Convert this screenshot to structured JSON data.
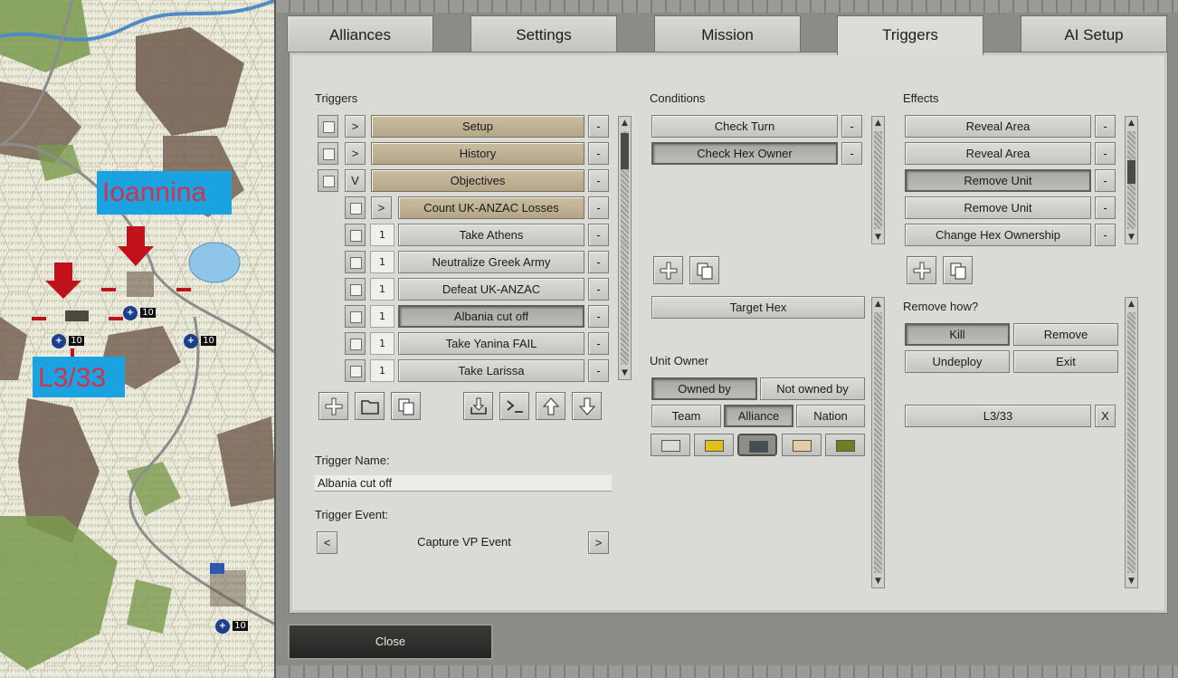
{
  "map": {
    "city_label": "Ioannina",
    "unit_label": "L3/33",
    "unit_strengths": [
      "10",
      "10",
      "10",
      "10"
    ]
  },
  "tabs": [
    "Alliances",
    "Settings",
    "Mission",
    "Triggers",
    "AI Setup"
  ],
  "active_tab": "Triggers",
  "triggers": {
    "header": "Triggers",
    "groups": [
      {
        "toggle": ">",
        "label": "Setup"
      },
      {
        "toggle": ">",
        "label": "History"
      },
      {
        "toggle": "V",
        "label": "Objectives"
      }
    ],
    "sub_group": {
      "toggle": ">",
      "label": "Count UK-ANZAC Losses"
    },
    "items": [
      {
        "num": "1",
        "label": "Take Athens"
      },
      {
        "num": "1",
        "label": "Neutralize Greek Army"
      },
      {
        "num": "1",
        "label": "Defeat UK-ANZAC"
      },
      {
        "num": "1",
        "label": "Albania cut off"
      },
      {
        "num": "1",
        "label": "Take Yanina FAIL"
      },
      {
        "num": "1",
        "label": "Take Larissa"
      }
    ],
    "remove_label": "-",
    "name_label": "Trigger Name:",
    "name_value": "Albania cut off",
    "event_label": "Trigger Event:",
    "event_value": "Capture VP Event",
    "prev": "<",
    "next": ">"
  },
  "conditions": {
    "header": "Conditions",
    "items": [
      "Check Turn",
      "Check Hex Owner"
    ],
    "target_hex": "Target Hex",
    "unit_owner_label": "Unit Owner",
    "owned_by": "Owned by",
    "not_owned_by": "Not owned by",
    "scope": [
      "Team",
      "Alliance",
      "Nation"
    ],
    "swatches": [
      "#d9dadc",
      "#e0c01a",
      "#474d55",
      "#e6cba8",
      "#6f7f22"
    ]
  },
  "effects": {
    "header": "Effects",
    "items": [
      "Reveal Area",
      "Reveal Area",
      "Remove Unit",
      "Remove Unit",
      "Change Hex Ownership"
    ],
    "remove_how_label": "Remove how?",
    "remove_how": [
      "Kill",
      "Remove",
      "Undeploy",
      "Exit"
    ],
    "unit": "L3/33",
    "unit_clear": "X"
  },
  "close": "Close",
  "icons": [
    "plus-icon",
    "folder-icon",
    "copy-icon",
    "import-icon",
    "console-icon",
    "arrow-up-icon",
    "arrow-down-icon"
  ]
}
